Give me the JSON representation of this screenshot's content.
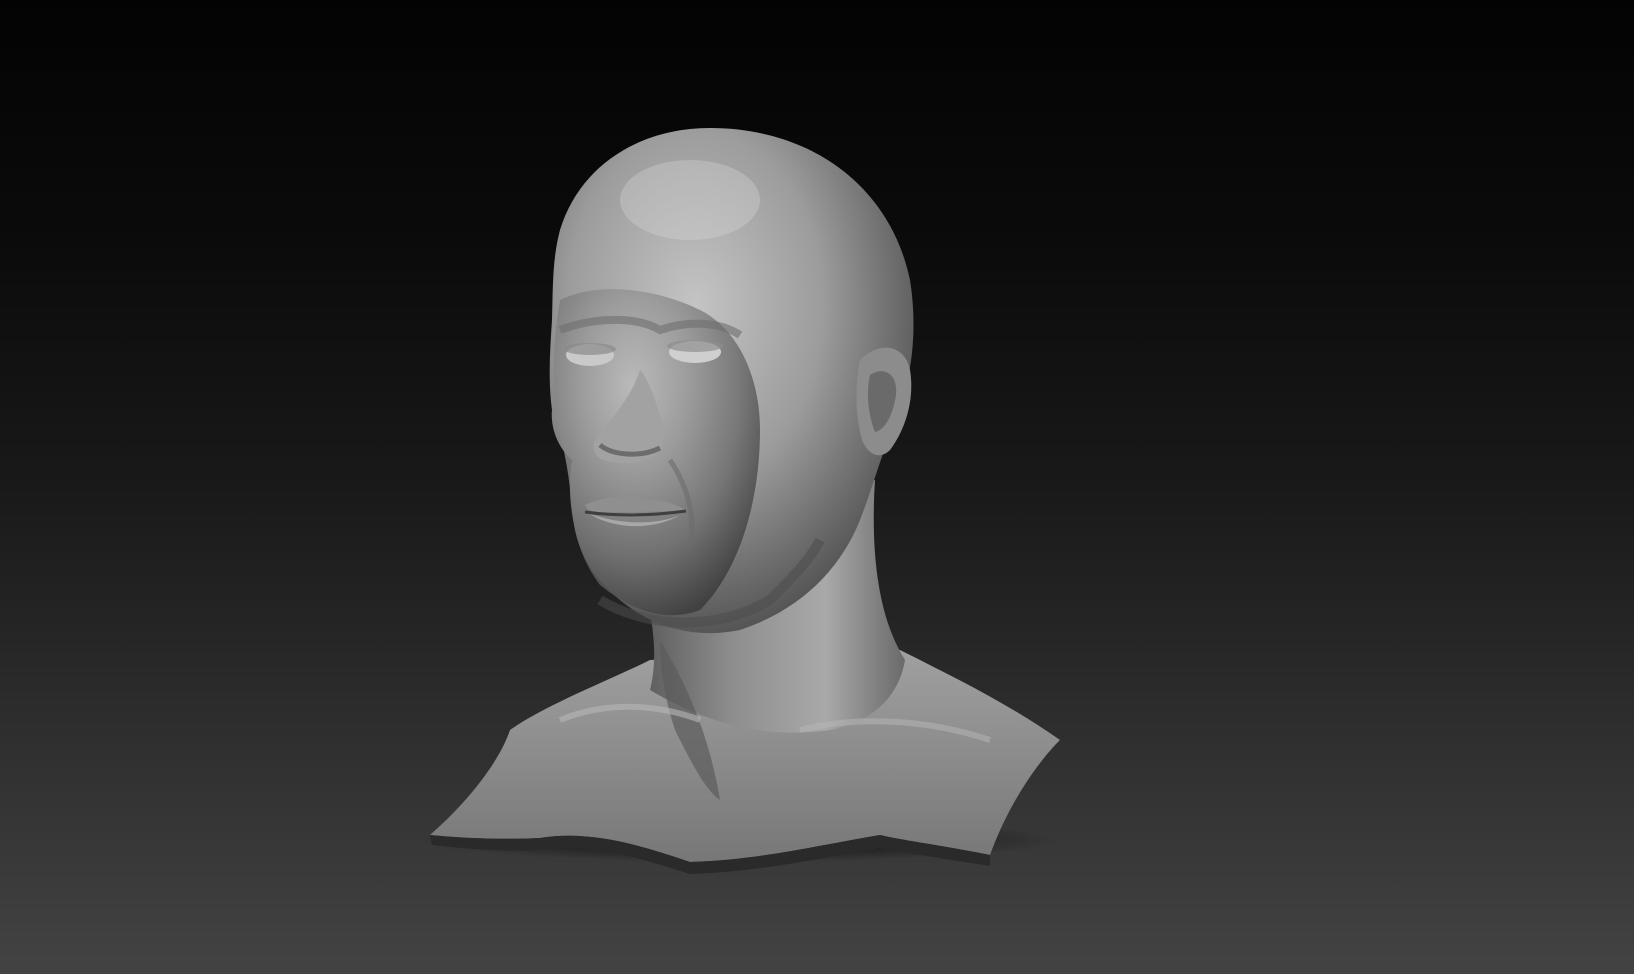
{
  "viewport": {
    "background_top": "#030303",
    "background_bottom": "#434343",
    "mesh_color": "#8a8a8a"
  },
  "sculpt": {
    "subject": "head-bust-sculpt"
  }
}
